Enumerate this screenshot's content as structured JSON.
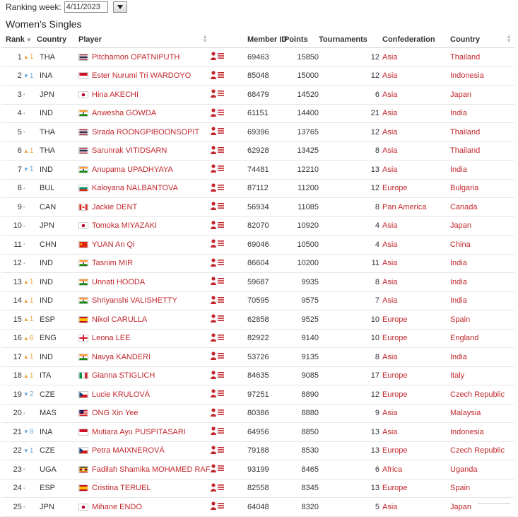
{
  "toolbar": {
    "ranking_week_label": "Ranking week:",
    "ranking_week_value": "4/11/2023"
  },
  "page_title": "Women's Singles",
  "columns": {
    "rank": "Rank",
    "country_code": "Country",
    "player": "Player",
    "member_id": "Member ID",
    "points": "Points",
    "tournaments": "Tournaments",
    "confederation": "Confederation",
    "country": "Country"
  },
  "colors": {
    "accent_red": "#c1272d",
    "move_up": "#e8a33a",
    "move_down": "#6aa7d8"
  },
  "rows": [
    {
      "rank": "1",
      "move": "up",
      "move_val": "1",
      "code": "THA",
      "player": "Pitchamon OPATNIPUTH",
      "member_id": "69463",
      "points": "15850",
      "tournaments": "12",
      "confed": "Asia",
      "country": "Thailand",
      "flag": "THA"
    },
    {
      "rank": "2",
      "move": "down",
      "move_val": "1",
      "code": "INA",
      "player": "Ester Nurumi Tri WARDOYO",
      "member_id": "85048",
      "points": "15000",
      "tournaments": "12",
      "confed": "Asia",
      "country": "Indonesia",
      "flag": "INA"
    },
    {
      "rank": "3",
      "move": "none",
      "move_val": "",
      "code": "JPN",
      "player": "Hina AKECHI",
      "member_id": "68479",
      "points": "14520",
      "tournaments": "6",
      "confed": "Asia",
      "country": "Japan",
      "flag": "JPN"
    },
    {
      "rank": "4",
      "move": "none",
      "move_val": "",
      "code": "IND",
      "player": "Anwesha GOWDA",
      "member_id": "61151",
      "points": "14400",
      "tournaments": "21",
      "confed": "Asia",
      "country": "India",
      "flag": "IND"
    },
    {
      "rank": "5",
      "move": "none",
      "move_val": "",
      "code": "THA",
      "player": "Sirada ROONGPIBOONSOPIT",
      "member_id": "69396",
      "points": "13765",
      "tournaments": "12",
      "confed": "Asia",
      "country": "Thailand",
      "flag": "THA"
    },
    {
      "rank": "6",
      "move": "up",
      "move_val": "1",
      "code": "THA",
      "player": "Sarunrak VITIDSARN",
      "member_id": "62928",
      "points": "13425",
      "tournaments": "8",
      "confed": "Asia",
      "country": "Thailand",
      "flag": "THA"
    },
    {
      "rank": "7",
      "move": "down",
      "move_val": "1",
      "code": "IND",
      "player": "Anupama UPADHYAYA",
      "member_id": "74481",
      "points": "12210",
      "tournaments": "13",
      "confed": "Asia",
      "country": "India",
      "flag": "IND"
    },
    {
      "rank": "8",
      "move": "none",
      "move_val": "",
      "code": "BUL",
      "player": "Kaloyana NALBANTOVA",
      "member_id": "87112",
      "points": "11200",
      "tournaments": "12",
      "confed": "Europe",
      "country": "Bulgaria",
      "flag": "BUL"
    },
    {
      "rank": "9",
      "move": "none",
      "move_val": "",
      "code": "CAN",
      "player": "Jackie DENT",
      "member_id": "56934",
      "points": "11085",
      "tournaments": "8",
      "confed": "Pan America",
      "country": "Canada",
      "flag": "CAN"
    },
    {
      "rank": "10",
      "move": "none",
      "move_val": "",
      "code": "JPN",
      "player": "Tomoka MIYAZAKI",
      "member_id": "82070",
      "points": "10920",
      "tournaments": "4",
      "confed": "Asia",
      "country": "Japan",
      "flag": "JPN"
    },
    {
      "rank": "11",
      "move": "none",
      "move_val": "",
      "code": "CHN",
      "player": "YUAN An Qi",
      "member_id": "69046",
      "points": "10500",
      "tournaments": "4",
      "confed": "Asia",
      "country": "China",
      "flag": "CHN"
    },
    {
      "rank": "12",
      "move": "none",
      "move_val": "",
      "code": "IND",
      "player": "Tasnim MIR",
      "member_id": "86604",
      "points": "10200",
      "tournaments": "11",
      "confed": "Asia",
      "country": "India",
      "flag": "IND"
    },
    {
      "rank": "13",
      "move": "up",
      "move_val": "1",
      "code": "IND",
      "player": "Unnati HOODA",
      "member_id": "59687",
      "points": "9935",
      "tournaments": "8",
      "confed": "Asia",
      "country": "India",
      "flag": "IND"
    },
    {
      "rank": "14",
      "move": "up",
      "move_val": "1",
      "code": "IND",
      "player": "Shriyanshi VALISHETTY",
      "member_id": "70595",
      "points": "9575",
      "tournaments": "7",
      "confed": "Asia",
      "country": "India",
      "flag": "IND"
    },
    {
      "rank": "15",
      "move": "up",
      "move_val": "1",
      "code": "ESP",
      "player": "Nikol CARULLA",
      "member_id": "62858",
      "points": "9525",
      "tournaments": "10",
      "confed": "Europe",
      "country": "Spain",
      "flag": "ESP"
    },
    {
      "rank": "16",
      "move": "up",
      "move_val": "6",
      "code": "ENG",
      "player": "Leona LEE",
      "member_id": "82922",
      "points": "9140",
      "tournaments": "10",
      "confed": "Europe",
      "country": "England",
      "flag": "ENG"
    },
    {
      "rank": "17",
      "move": "up",
      "move_val": "1",
      "code": "IND",
      "player": "Navya KANDERI",
      "member_id": "53726",
      "points": "9135",
      "tournaments": "8",
      "confed": "Asia",
      "country": "India",
      "flag": "IND"
    },
    {
      "rank": "18",
      "move": "up",
      "move_val": "1",
      "code": "ITA",
      "player": "Gianna STIGLICH",
      "member_id": "84635",
      "points": "9085",
      "tournaments": "17",
      "confed": "Europe",
      "country": "Italy",
      "flag": "ITA"
    },
    {
      "rank": "19",
      "move": "down",
      "move_val": "2",
      "code": "CZE",
      "player": "Lucie KRULOVÁ",
      "member_id": "97251",
      "points": "8890",
      "tournaments": "12",
      "confed": "Europe",
      "country": "Czech Republic",
      "flag": "CZE"
    },
    {
      "rank": "20",
      "move": "none",
      "move_val": "",
      "code": "MAS",
      "player": "ONG Xin Yee",
      "member_id": "80386",
      "points": "8880",
      "tournaments": "9",
      "confed": "Asia",
      "country": "Malaysia",
      "flag": "MAS"
    },
    {
      "rank": "21",
      "move": "down",
      "move_val": "8",
      "code": "INA",
      "player": "Mutiara Ayu PUSPITASARI",
      "member_id": "64956",
      "points": "8850",
      "tournaments": "13",
      "confed": "Asia",
      "country": "Indonesia",
      "flag": "INA"
    },
    {
      "rank": "22",
      "move": "down",
      "move_val": "1",
      "code": "CZE",
      "player": "Petra MAIXNEROVÁ",
      "member_id": "79188",
      "points": "8530",
      "tournaments": "13",
      "confed": "Europe",
      "country": "Czech Republic",
      "flag": "CZE"
    },
    {
      "rank": "23",
      "move": "none",
      "move_val": "",
      "code": "UGA",
      "player": "Fadilah Shamika MOHAMED RAFI",
      "member_id": "93199",
      "points": "8465",
      "tournaments": "6",
      "confed": "Africa",
      "country": "Uganda",
      "flag": "UGA"
    },
    {
      "rank": "24",
      "move": "none",
      "move_val": "",
      "code": "ESP",
      "player": "Cristina TERUEL",
      "member_id": "82558",
      "points": "8345",
      "tournaments": "13",
      "confed": "Europe",
      "country": "Spain",
      "flag": "ESP"
    },
    {
      "rank": "25",
      "move": "none",
      "move_val": "",
      "code": "JPN",
      "player": "Mihane ENDO",
      "member_id": "64048",
      "points": "8320",
      "tournaments": "5",
      "confed": "Asia",
      "country": "Japan",
      "flag": "JPN"
    }
  ]
}
